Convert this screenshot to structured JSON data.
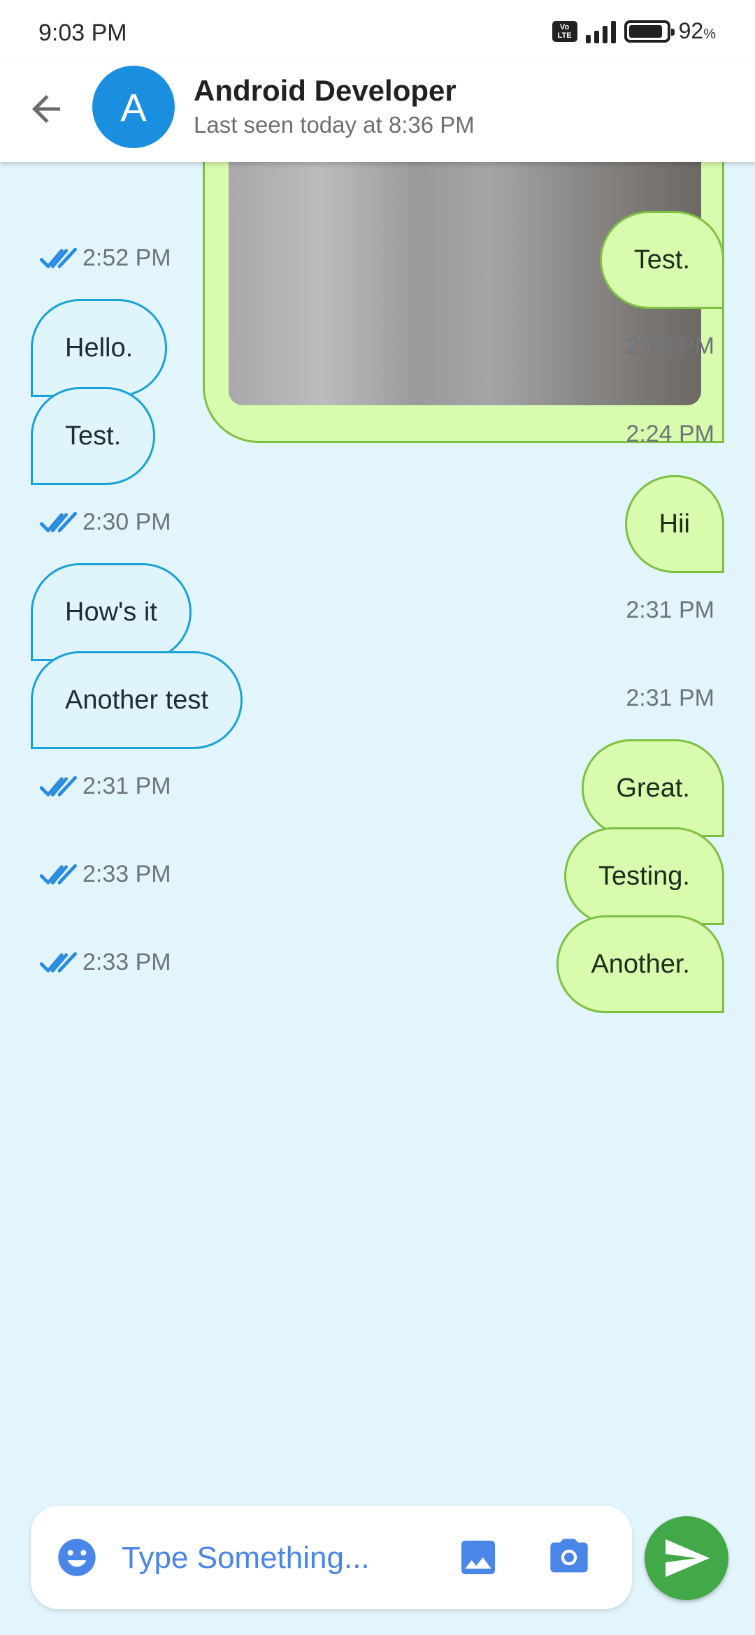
{
  "status_bar": {
    "time": "9:03 PM",
    "network_badge": "Vo LTE",
    "signal_bars": 4,
    "battery_level": 0.92,
    "battery_percent": "92",
    "battery_unit": "%"
  },
  "header": {
    "back_icon": "arrow-back-icon",
    "avatar_letter": "A",
    "contact_name": "Android Developer",
    "last_seen": "Last seen today at 8:36 PM"
  },
  "messages": [
    {
      "direction": "out",
      "text": "Test.",
      "time": "2:52 PM",
      "status": "read"
    },
    {
      "direction": "in",
      "text": "Hello.",
      "time": "2:13 PM"
    },
    {
      "direction": "in",
      "text": "Test.",
      "time": "2:24 PM"
    },
    {
      "direction": "out",
      "text": "Hii",
      "time": "2:30 PM",
      "status": "read"
    },
    {
      "direction": "in",
      "text": "How's it",
      "time": "2:31 PM"
    },
    {
      "direction": "in",
      "text": "Another test",
      "time": "2:31 PM"
    },
    {
      "direction": "out",
      "text": "Great.",
      "time": "2:31 PM",
      "status": "read"
    },
    {
      "direction": "out",
      "text": "Testing.",
      "time": "2:33 PM",
      "status": "read"
    },
    {
      "direction": "out",
      "text": "Another.",
      "time": "2:33 PM",
      "status": "read"
    }
  ],
  "composer": {
    "placeholder": "Type Something...",
    "emoji_icon": "emoji-icon",
    "gallery_icon": "image-icon",
    "camera_icon": "camera-icon",
    "send_icon": "send-icon"
  },
  "colors": {
    "background": "#e3f5fc",
    "outgoing_bubble": "#d9fbae",
    "outgoing_border": "#7cc142",
    "incoming_bubble": "#e0f4fd",
    "incoming_border": "#1aa2d8",
    "avatar": "#1a8fe0",
    "accent_blue": "#4a86e8",
    "send_button": "#43a848"
  }
}
